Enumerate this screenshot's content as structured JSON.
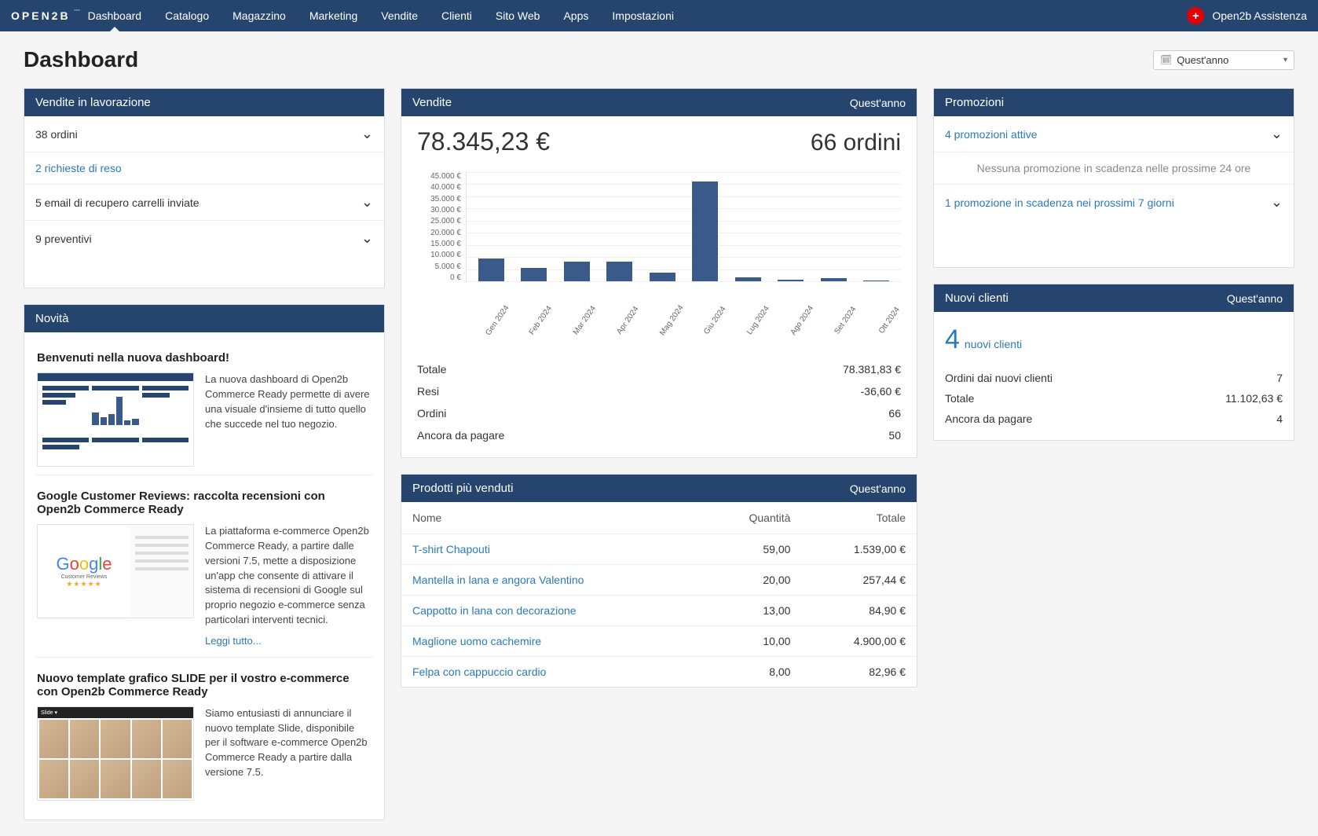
{
  "brand": "OPEN2B",
  "nav": {
    "items": [
      "Dashboard",
      "Catalogo",
      "Magazzino",
      "Marketing",
      "Vendite",
      "Clienti",
      "Sito Web",
      "Apps",
      "Impostazioni"
    ],
    "active": 0,
    "assistance_label": "Open2b Assistenza",
    "assistance_icon": "+"
  },
  "page": {
    "title": "Dashboard",
    "period": "Quest'anno"
  },
  "vendite_lavorazione": {
    "title": "Vendite in lavorazione",
    "rows": [
      {
        "text": "38 ordini",
        "link": false,
        "expand": true
      },
      {
        "text": "2 richieste di reso",
        "link": true,
        "expand": false
      },
      {
        "text": "5 email di recupero carrelli inviate",
        "link": false,
        "expand": true
      },
      {
        "text": "9 preventivi",
        "link": false,
        "expand": true
      }
    ]
  },
  "novita": {
    "title": "Novità",
    "items": [
      {
        "title": "Benvenuti nella nuova dashboard!",
        "text": "La nuova dashboard di Open2b Commerce Ready permette di avere una visuale d'insieme di tutto quello che succede nel tuo negozio.",
        "readmore": ""
      },
      {
        "title": "Google Customer Reviews: raccolta recensioni con Open2b Commerce Ready",
        "text": "La piattaforma e-commerce Open2b Commerce Ready, a partire dalle versioni 7.5, mette a disposizione un'app che consente di attivare il sistema di recensioni di Google sul proprio negozio e-commerce senza particolari interventi tecnici.",
        "readmore": "Leggi tutto..."
      },
      {
        "title": "Nuovo template grafico SLIDE per il vostro e-commerce con Open2b Commerce Ready",
        "text": "Siamo entusiasti di annunciare il nuovo template Slide, disponibile per il software e-commerce Open2b Commerce Ready a partire dalla versione 7.5.",
        "readmore": ""
      }
    ]
  },
  "vendite": {
    "title": "Vendite",
    "period": "Quest'anno",
    "amount": "78.345,23 €",
    "orders": "66 ordini",
    "stats": [
      {
        "label": "Totale",
        "value": "78.381,83 €"
      },
      {
        "label": "Resi",
        "value": "-36,60 €"
      },
      {
        "label": "Ordini",
        "value": "66"
      },
      {
        "label": "Ancora da pagare",
        "value": "50"
      }
    ]
  },
  "chart_data": {
    "type": "bar",
    "title": "Vendite",
    "xlabel": "",
    "ylabel": "€",
    "ylim": [
      0,
      45000
    ],
    "yticks": [
      0,
      5000,
      10000,
      15000,
      20000,
      25000,
      30000,
      35000,
      40000,
      45000
    ],
    "ytick_labels": [
      "0 €",
      "5.000 €",
      "10.000 €",
      "15.000 €",
      "20.000 €",
      "25.000 €",
      "30.000 €",
      "35.000 €",
      "40.000 €",
      "45.000 €"
    ],
    "categories": [
      "Gen 2024",
      "Feb 2024",
      "Mar 2024",
      "Apr 2024",
      "Mag 2024",
      "Giu 2024",
      "Lug 2024",
      "Ago 2024",
      "Set 2024",
      "Ott 2024"
    ],
    "values": [
      9500,
      5500,
      8000,
      8000,
      3500,
      41000,
      1500,
      500,
      1200,
      300
    ]
  },
  "promozioni": {
    "title": "Promozioni",
    "rows": [
      {
        "text": "4 promozioni attive",
        "link": true,
        "expand": true,
        "muted": false
      },
      {
        "text": "Nessuna promozione in scadenza nelle prossime 24 ore",
        "link": false,
        "expand": false,
        "muted": true
      },
      {
        "text": "1 promozione in scadenza nei prossimi 7 giorni",
        "link": true,
        "expand": true,
        "muted": false
      }
    ]
  },
  "nuovi_clienti": {
    "title": "Nuovi clienti",
    "period": "Quest'anno",
    "count": "4",
    "count_label": "nuovi clienti",
    "stats": [
      {
        "label": "Ordini dai nuovi clienti",
        "value": "7"
      },
      {
        "label": "Totale",
        "value": "11.102,63 €"
      },
      {
        "label": "Ancora da pagare",
        "value": "4"
      }
    ]
  },
  "prodotti": {
    "title": "Prodotti più venduti",
    "period": "Quest'anno",
    "columns": [
      "Nome",
      "Quantità",
      "Totale"
    ],
    "rows": [
      {
        "name": "T-shirt Chapouti",
        "qty": "59,00",
        "total": "1.539,00 €"
      },
      {
        "name": "Mantella in lana e angora Valentino",
        "qty": "20,00",
        "total": "257,44 €"
      },
      {
        "name": "Cappotto in lana con decorazione",
        "qty": "13,00",
        "total": "84,90 €"
      },
      {
        "name": "Maglione uomo cachemire",
        "qty": "10,00",
        "total": "4.900,00 €"
      },
      {
        "name": "Felpa con cappuccio cardio",
        "qty": "8,00",
        "total": "82,96 €"
      }
    ]
  }
}
